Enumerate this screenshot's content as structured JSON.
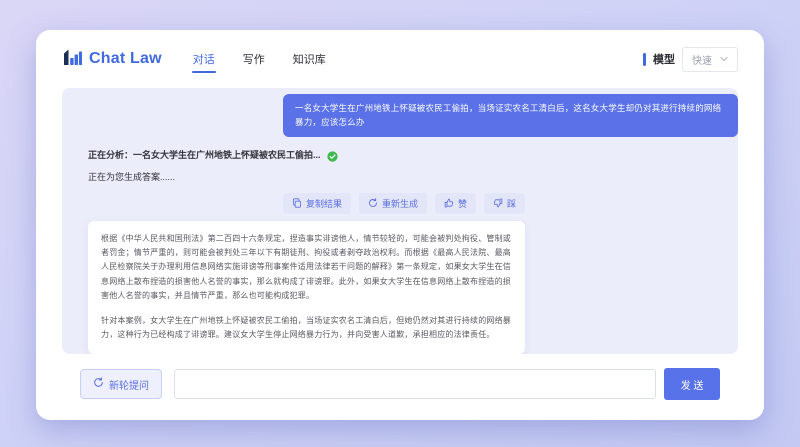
{
  "header": {
    "logo_text": "Chat Law",
    "nav": [
      {
        "label": "对话",
        "active": true
      },
      {
        "label": "写作",
        "active": false
      },
      {
        "label": "知识库",
        "active": false
      }
    ],
    "model_label": "模型",
    "model_value": "快速"
  },
  "chat": {
    "user_message": "一名女大学生在广州地铁上怀疑被农民工偷拍，当场证实农名工清白后，这名女大学生却仍对其进行持续的网络暴力，应该怎么办",
    "status_analyzing": "正在分析：一名女大学生在广州地铁上怀疑被农民工偷拍...",
    "status_generating": "正在为您生成答案......",
    "actions": {
      "copy": "复制结果",
      "regenerate": "重新生成",
      "like": "赞",
      "dislike": "踩"
    },
    "answer_paragraphs": [
      "根据《中华人民共和国刑法》第二百四十六条规定，捏造事实诽谤他人，情节较轻的，可能会被判处拘役、管制或者罚金；情节严重的，则可能会被判处三年以下有期徒刑、拘役或者剥夺政治权利。而根据《最高人民法院、最高人民检察院关于办理利用信息网络实施诽谤等刑事案件适用法律若干问题的解释》第一条规定，如果女大学生在信息网络上散布捏造的损害他人名誉的事实，那么就构成了诽谤罪。此外，如果女大学生在信息网络上散布捏造的损害他人名誉的事实，并且情节严重，那么也可能构成犯罪。",
      "针对本案例，女大学生在广州地铁上怀疑被农民工偷拍，当场证实农名工清白后，但她仍然对其进行持续的网络暴力，这种行为已经构成了诽谤罪。建议女大学生停止网络暴力行为，并向受害人道歉，承担相应的法律责任。"
    ]
  },
  "composer": {
    "new_round": "新轮提问",
    "input_value": "",
    "send": "发 送"
  },
  "colors": {
    "accent": "#4169e1",
    "bubble": "#5a71e8",
    "send": "#5873ea",
    "action_text": "#5b6ee0",
    "chat_bg": "#ecedfa",
    "success": "#3fb950",
    "page_top": "#dad6f6",
    "page_bottom": "#c3c9f2"
  }
}
